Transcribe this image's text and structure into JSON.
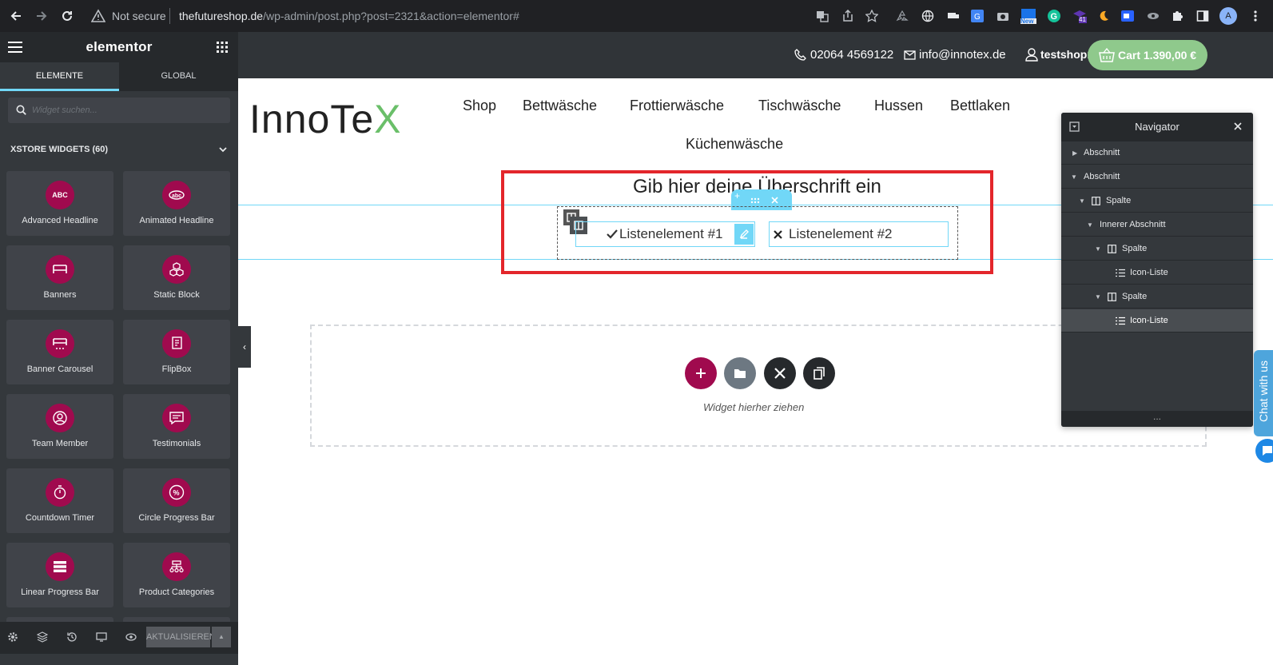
{
  "browser": {
    "not_secure": "Not secure",
    "url_host": "thefutureshop.de",
    "url_path": "/wp-admin/post.php?post=2321&action=elementor#",
    "badge_new": "New",
    "badge_41": "41",
    "profile_initial": "A"
  },
  "sidebar": {
    "logo": "elementor",
    "tabs": [
      "ELEMENTE",
      "GLOBAL"
    ],
    "search_placeholder": "Widget suchen...",
    "category": "XSTORE WIDGETS (60)",
    "widgets": [
      {
        "label": "Advanced Headline",
        "icon": "abc-icon",
        "glyph": "ABC"
      },
      {
        "label": "Animated Headline",
        "icon": "animated-abc-icon",
        "glyph": "abc"
      },
      {
        "label": "Banners",
        "icon": "banner-icon",
        "glyph": ""
      },
      {
        "label": "Static Block",
        "icon": "cubes-icon",
        "glyph": ""
      },
      {
        "label": "Banner Carousel",
        "icon": "banner-carousel-icon",
        "glyph": ""
      },
      {
        "label": "FlipBox",
        "icon": "flipbox-icon",
        "glyph": ""
      },
      {
        "label": "Team Member",
        "icon": "person-icon",
        "glyph": ""
      },
      {
        "label": "Testimonials",
        "icon": "chat-icon",
        "glyph": ""
      },
      {
        "label": "Countdown Timer",
        "icon": "stopwatch-icon",
        "glyph": ""
      },
      {
        "label": "Circle Progress Bar",
        "icon": "percent-icon",
        "glyph": "%"
      },
      {
        "label": "Linear Progress Bar",
        "icon": "bars-icon",
        "glyph": ""
      },
      {
        "label": "Product Categories",
        "icon": "categories-icon",
        "glyph": ""
      }
    ],
    "update_button": "AKTUALISIEREN",
    "accent_color": "#a00a4e"
  },
  "site": {
    "phone": "02064 4569122",
    "email": "info@innotex.de",
    "user": "testshop1",
    "cart": "Cart 1.390,00 €",
    "logo_main": "InnoTe",
    "logo_x": "X",
    "menu": [
      "Shop",
      "Bettwäsche",
      "Frottierwäsche",
      "Tischwäsche",
      "Hussen",
      "Bettlaken",
      "Küchenwäsche"
    ],
    "headline": "Gib hier deine Überschrift ein",
    "list_item_1": "Listenelement #1",
    "list_item_2": "Listenelement #2",
    "drop_text": "Widget hierher ziehen"
  },
  "navigator": {
    "title": "Navigator",
    "rows": [
      {
        "label": "Abschnitt",
        "level": 0,
        "expanded": false
      },
      {
        "label": "Abschnitt",
        "level": 0,
        "expanded": true
      },
      {
        "label": "Spalte",
        "level": 1,
        "expanded": true
      },
      {
        "label": "Innerer Abschnitt",
        "level": 2,
        "expanded": true
      },
      {
        "label": "Spalte",
        "level": 3,
        "expanded": true
      },
      {
        "label": "Icon-Liste",
        "level": 4,
        "expanded": false
      },
      {
        "label": "Spalte",
        "level": 3,
        "expanded": true
      },
      {
        "label": "Icon-Liste",
        "level": 4,
        "expanded": false
      }
    ],
    "footer": "..."
  },
  "chat": {
    "label": "Chat with us"
  }
}
